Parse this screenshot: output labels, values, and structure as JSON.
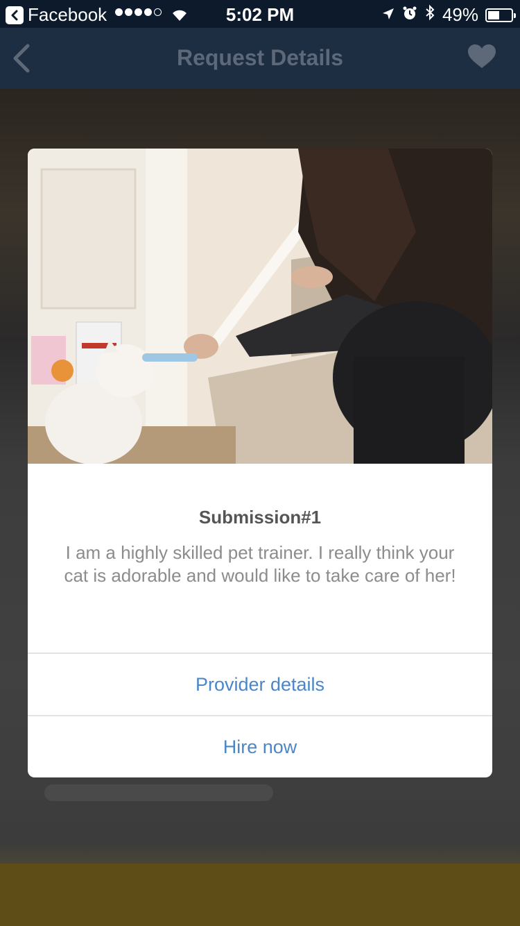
{
  "status_bar": {
    "back_app": "Facebook",
    "time": "5:02 PM",
    "battery_label": "49%",
    "battery_level": 0.49
  },
  "nav": {
    "title": "Request Details",
    "back_icon": "chevron-left-icon",
    "favorite_icon": "heart-icon"
  },
  "modal": {
    "photo": "photo-woman-feeding-cat",
    "title": "Submission#1",
    "description": "I am a highly skilled pet trainer. I really think your cat is adorable and would like to take care of her!",
    "actions": {
      "provider_details": "Provider details",
      "hire_now": "Hire now"
    }
  },
  "colors": {
    "nav_bg": "#1d2d42",
    "status_bg": "#0c1a2c",
    "action_text": "#4a86c8"
  }
}
